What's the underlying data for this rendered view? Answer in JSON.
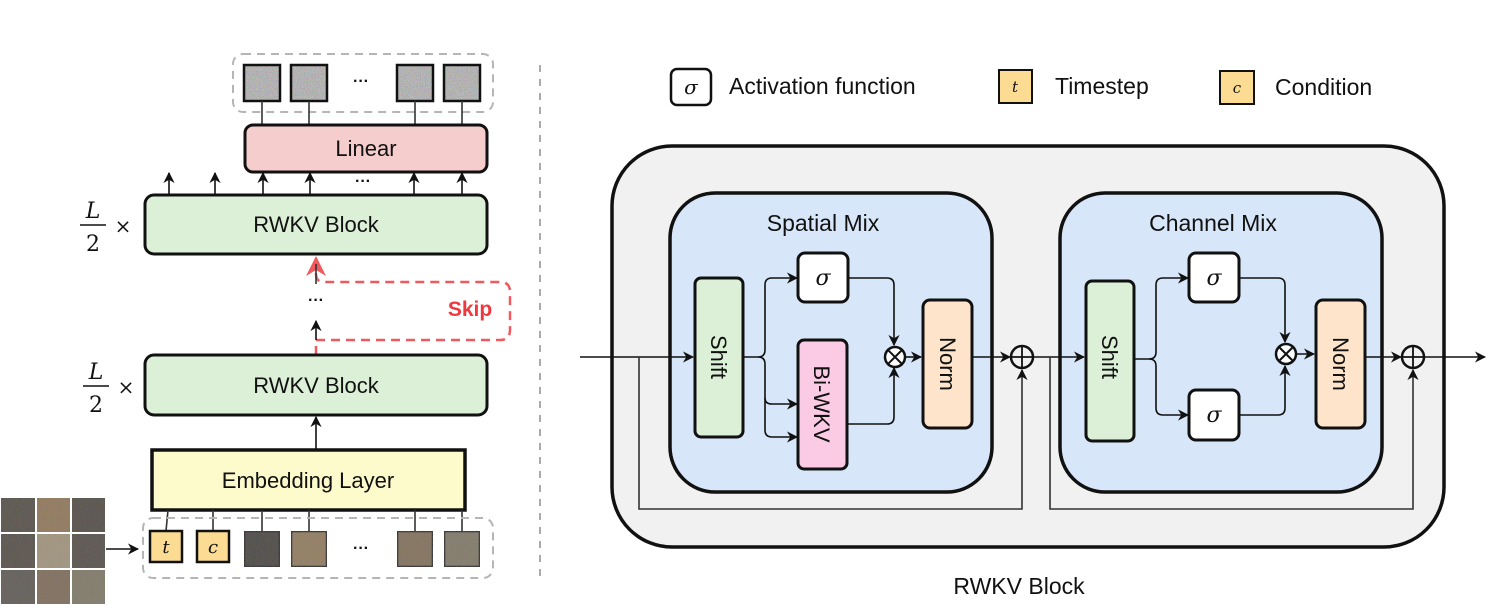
{
  "left_panel": {
    "output_tokens": {
      "ellipsis": "···"
    },
    "linear": {
      "label": "Linear",
      "color": "#f6cdcd"
    },
    "linear_ellipsis": "···",
    "rwkv_top": {
      "label": "RWKV Block",
      "multiplier_num": "L",
      "multiplier_den": "2",
      "times": "×",
      "color": "#dcefd7"
    },
    "skip": {
      "label": "Skip",
      "color": "#f0393f"
    },
    "middle_ellipsis": "···",
    "rwkv_bottom": {
      "label": "RWKV Block",
      "multiplier_num": "L",
      "multiplier_den": "2",
      "times": "×",
      "color": "#dcefd7"
    },
    "embedding": {
      "label": "Embedding Layer",
      "color": "#fdfbcc"
    },
    "input_tokens": {
      "timestep": "t",
      "condition": "c",
      "ellipsis": "···",
      "token_color": "#fbdc92"
    },
    "input_image": {
      "name": "patchified noisy dog image"
    }
  },
  "legend": {
    "items": [
      {
        "symbol": "σ",
        "label": "Activation function",
        "fill": "#ffffff"
      },
      {
        "symbol": "t",
        "label": "Timestep",
        "fill": "#fbdc92"
      },
      {
        "symbol": "c",
        "label": "Condition",
        "fill": "#fbdc92"
      }
    ]
  },
  "right_panel": {
    "caption": "RWKV Block",
    "outer_color": "#f0f1f0",
    "mix_color": "#d7e6f8",
    "spatial_mix": {
      "title": "Spatial Mix",
      "shift": "Shift",
      "activation": "σ",
      "biwkv": "Bi-WKV",
      "norm": "Norm",
      "multiply": "⊗"
    },
    "channel_mix": {
      "title": "Channel Mix",
      "shift": "Shift",
      "activation_top": "σ",
      "activation_bottom": "σ",
      "norm": "Norm",
      "multiply": "⊗"
    },
    "add_symbol": "⊕",
    "colors": {
      "shift": "#dcefd7",
      "biwkv": "#fbcbe6",
      "norm": "#fde4cb",
      "sigma": "#ffffff"
    }
  }
}
